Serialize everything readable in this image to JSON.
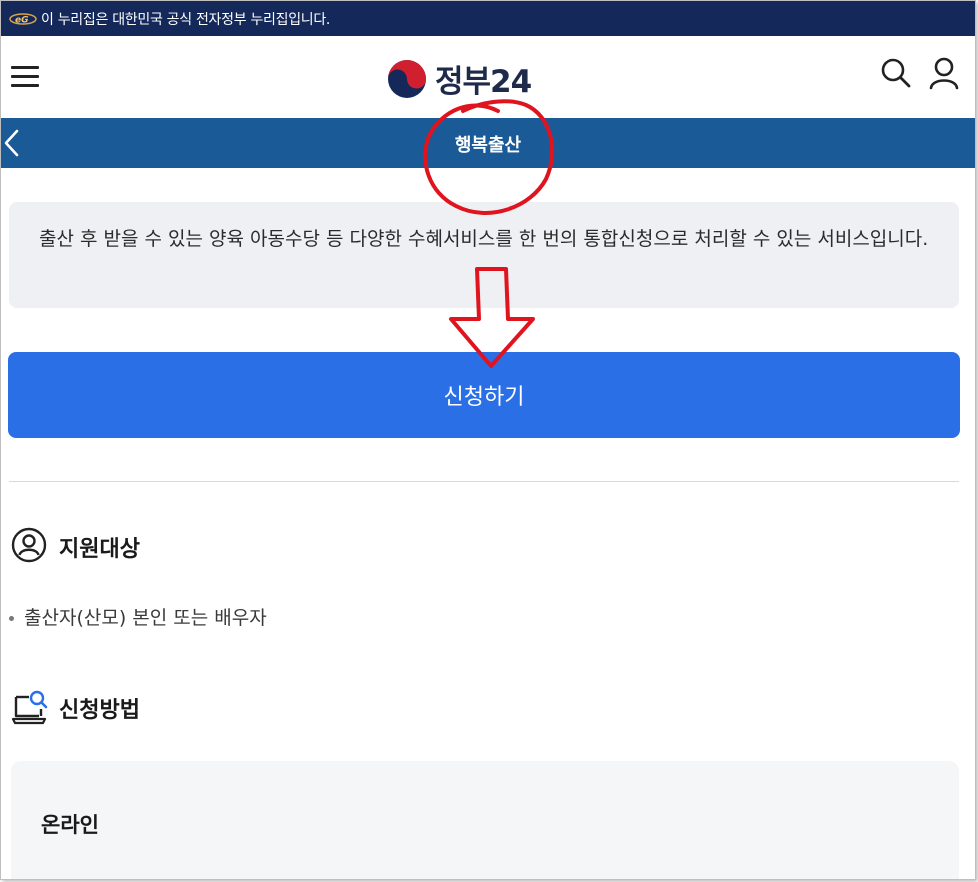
{
  "gov_banner": {
    "text": "이 누리집은 대한민국 공식 전자정부 누리집입니다.",
    "logo": "eg-logo"
  },
  "header": {
    "brand": "정부24",
    "icons": [
      "menu-icon",
      "taegeuk-logo",
      "search-icon",
      "user-icon"
    ]
  },
  "titlebar": {
    "title": "행복출산"
  },
  "description": "출산 후 받을 수 있는 양육 아동수당 등 다양한 수혜서비스를 한 번의 통합신청으로 처리할 수 있는 서비스입니다.",
  "apply_button": {
    "label": "신청하기"
  },
  "target_section": {
    "title": "지원대상",
    "items": [
      "출산자(산모) 본인 또는 배우자"
    ]
  },
  "method_section": {
    "title": "신청방법",
    "card_title": "온라인"
  },
  "colors": {
    "banner": "#14285a",
    "titlebar": "#1a5a96",
    "button": "#2b6fe6",
    "annotation": "#e0141e"
  }
}
